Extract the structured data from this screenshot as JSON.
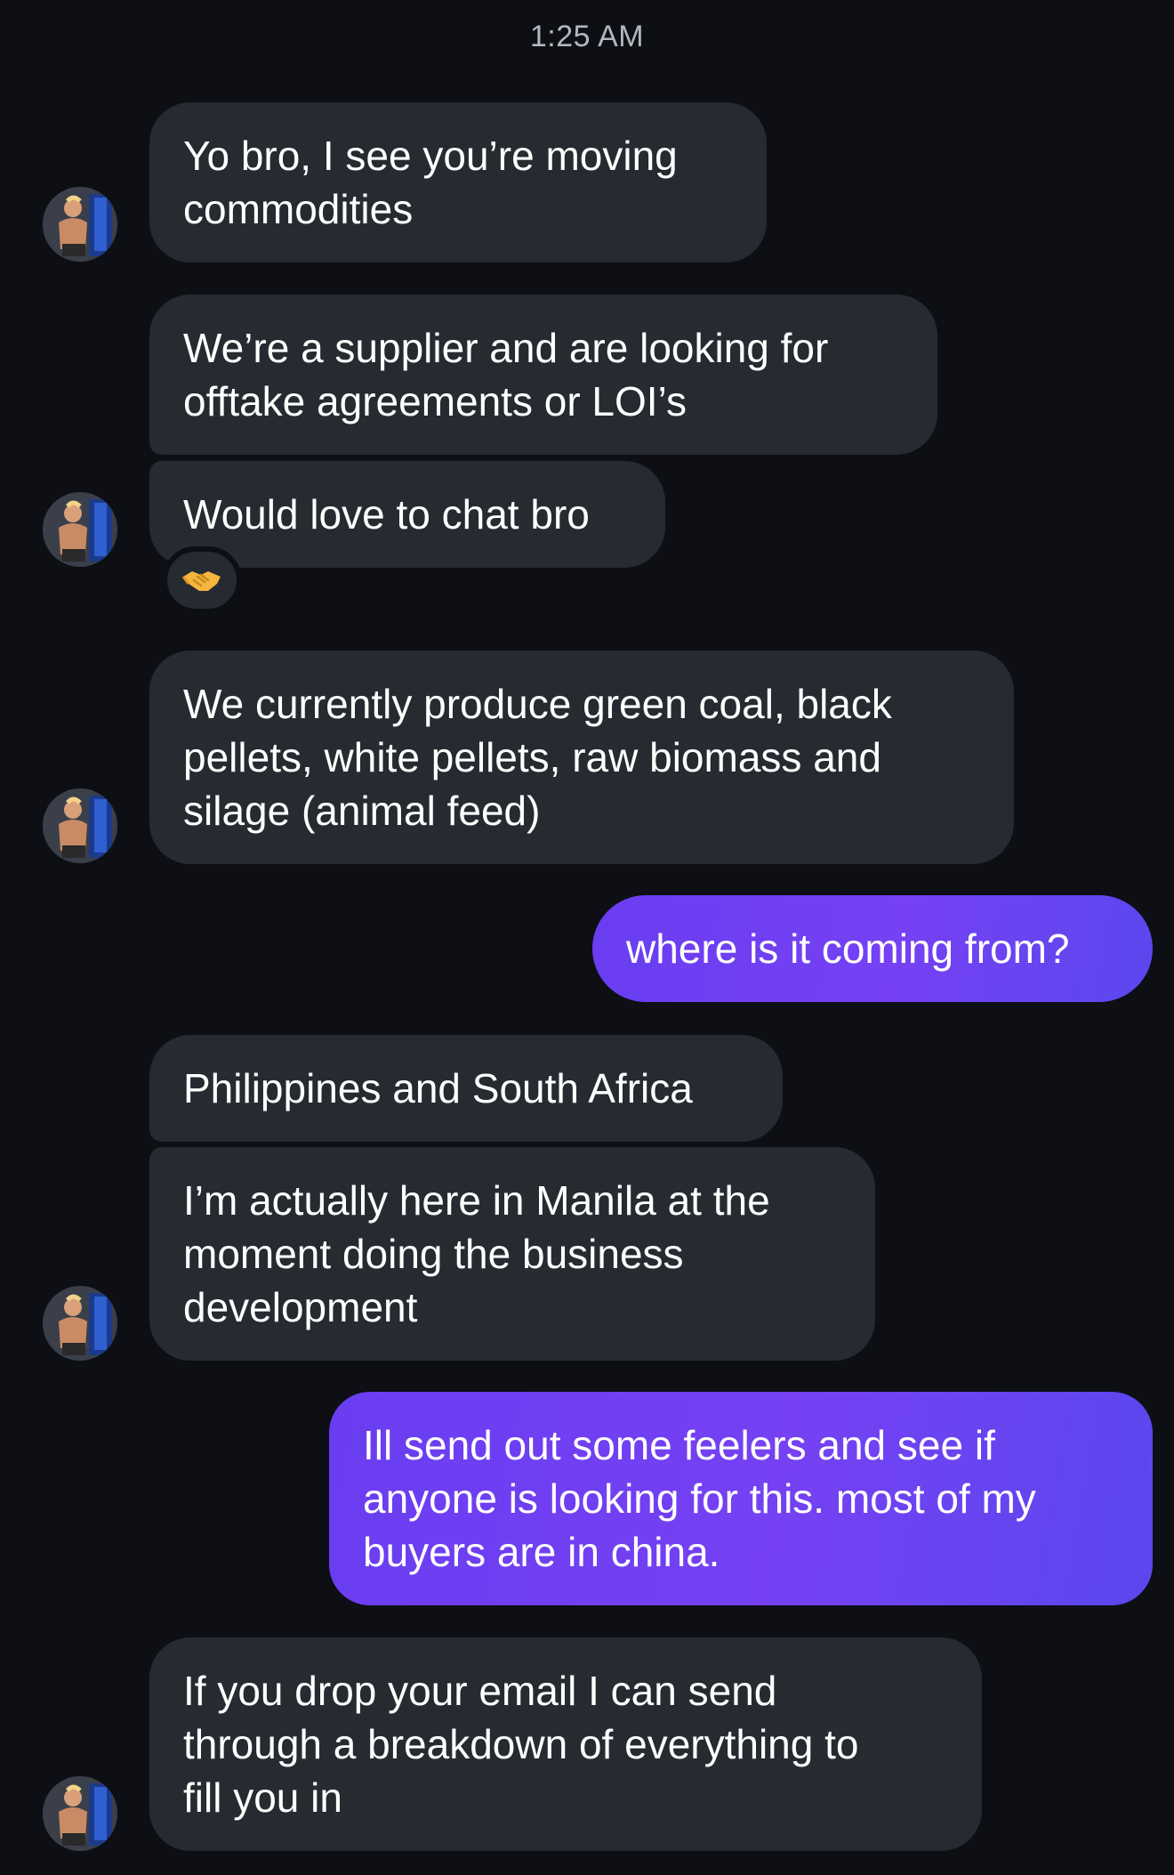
{
  "timestamp": "1:25 AM",
  "messages": [
    {
      "from": "them",
      "text": "Yo bro, I see you’re moving\ncommodities"
    },
    {
      "from": "them",
      "text": "We’re a supplier and are looking for\nofftake agreements or LOI’s"
    },
    {
      "from": "them",
      "text": "Would love to chat bro",
      "reaction": "handshake-icon"
    },
    {
      "from": "them",
      "text": "We currently produce green coal, black\npellets, white pellets, raw biomass and\nsilage (animal feed)"
    },
    {
      "from": "me",
      "text": "where is it coming from?"
    },
    {
      "from": "them",
      "text": "Philippines and South Africa"
    },
    {
      "from": "them",
      "text": "I’m actually here in Manila at the\nmoment doing the business\ndevelopment"
    },
    {
      "from": "me",
      "text": "Ill send out some feelers and see if\nanyone is looking for this. most of my\nbuyers are in china."
    },
    {
      "from": "them",
      "text": "If you drop your email I can send\nthrough a breakdown of everything to\nfill you in"
    }
  ],
  "colors": {
    "background": "#0d0f14",
    "incoming_bubble": "#262a31",
    "outgoing_bubble": "#6a3df1",
    "timestamp_text": "#b3b6bd"
  }
}
